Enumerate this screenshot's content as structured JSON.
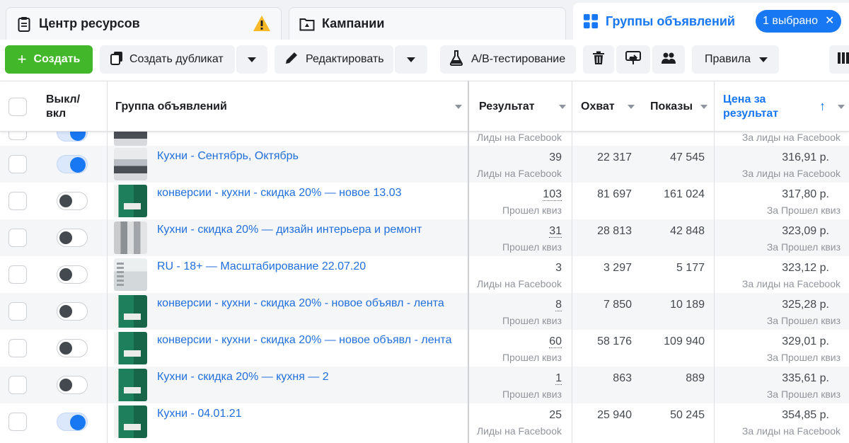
{
  "tabs": {
    "resources": {
      "label": "Центр ресурсов"
    },
    "campaigns": {
      "label": "Кампании"
    },
    "adsets": {
      "label": "Группы объявлений",
      "selected_badge": "1 выбрано"
    }
  },
  "toolbar": {
    "create_label": "Создать",
    "duplicate_label": "Создать дубликат",
    "edit_label": "Редактировать",
    "ab_test_label": "A/B-тестирование",
    "rules_label": "Правила"
  },
  "columns": {
    "toggle": "Выкл/\nвкл",
    "adset": "Группа объявлений",
    "result": "Результат",
    "reach": "Охват",
    "impressions": "Показы",
    "cost": "Цена за\nрезультат"
  },
  "partial_row": {
    "result_sub": "Лиды на Facebook",
    "cost_sub": "За лиды на Facebook"
  },
  "rows": [
    {
      "on": true,
      "thumb": "kitchen",
      "name": "Кухни - Сентябрь, Октябрь",
      "result": "39",
      "result_sub": "Лиды на Facebook",
      "reach": "22 317",
      "impressions": "47 545",
      "cost": "316,91 р.",
      "cost_sub": "За лиды на Facebook"
    },
    {
      "on": false,
      "thumb": "green",
      "name": "конверсии - кухни - скидка 20% — новое 13.03",
      "result": "103",
      "result_sub": "Прошел квиз",
      "reach": "81 697",
      "impressions": "161 024",
      "cost": "317,80 р.",
      "cost_sub": "За Прошел квиз"
    },
    {
      "on": false,
      "thumb": "grey",
      "name": "Кухни - скидка 20% — дизайн интерьера и ремонт",
      "result": "31",
      "result_sub": "Прошел квиз",
      "reach": "28 813",
      "impressions": "42 848",
      "cost": "323,09 р.",
      "cost_sub": "За Прошел квиз"
    },
    {
      "on": false,
      "thumb": "light",
      "name": "RU - 18+ — Масштабирование 22.07.20",
      "result": "3",
      "result_sub": "Лиды на Facebook",
      "reach": "3 297",
      "impressions": "5 177",
      "cost": "323,12 р.",
      "cost_sub": "За лиды на Facebook"
    },
    {
      "on": false,
      "thumb": "green",
      "name": "конверсии - кухни - скидка 20% - новое объявл - лента",
      "result": "8",
      "result_sub": "Прошел квиз",
      "reach": "7 850",
      "impressions": "10 189",
      "cost": "325,28 р.",
      "cost_sub": "За Прошел квиз"
    },
    {
      "on": false,
      "thumb": "green",
      "name": "конверсии - кухни - скидка 20% — новое объявл - лента",
      "result": "60",
      "result_sub": "Прошел квиз",
      "reach": "58 176",
      "impressions": "109 940",
      "cost": "329,01 р.",
      "cost_sub": "За Прошел квиз"
    },
    {
      "on": false,
      "thumb": "green",
      "name": "Кухни - скидка 20% — кухня — 2",
      "result": "1",
      "result_sub": "Прошел квиз",
      "reach": "863",
      "impressions": "889",
      "cost": "335,61 р.",
      "cost_sub": "За Прошел квиз"
    },
    {
      "on": true,
      "thumb": "green",
      "name": "Кухни - 04.01.21",
      "result": "25",
      "result_sub": "Лиды на Facebook",
      "reach": "25 940",
      "impressions": "50 245",
      "cost": "354,85 р.",
      "cost_sub": "За лиды на Facebook"
    }
  ],
  "colors": {
    "accent": "#1877f2",
    "create_green": "#42b72a",
    "link": "#216fdb"
  }
}
